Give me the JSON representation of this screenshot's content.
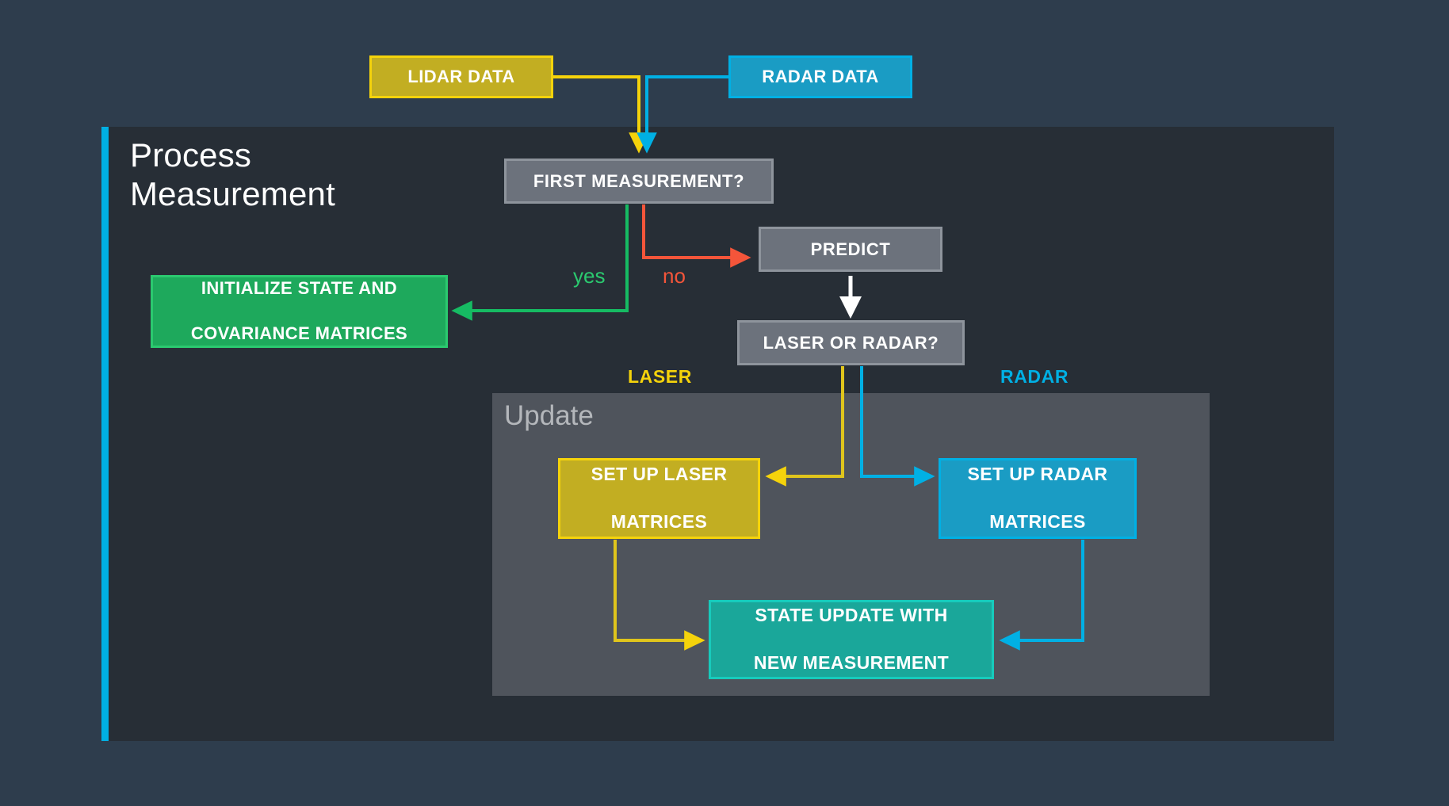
{
  "diagram": {
    "title": "Process Measurement",
    "colors": {
      "background": "#2e3d4d",
      "panel": "#272e36",
      "accent_bar": "#00b0e4",
      "update_panel": "#4f545c",
      "lidar_yellow": "#f5d30b",
      "radar_blue": "#00b0e4",
      "green": "#2bc96f",
      "red": "#f4553a",
      "teal": "#17cbbc",
      "decision_gray": "#6c727c",
      "white": "#ffffff"
    }
  },
  "inputs": [
    {
      "id": "lidar",
      "label": "LIDAR DATA",
      "color": "#f5d30b"
    },
    {
      "id": "radar",
      "label": "RADAR DATA",
      "color": "#00b0e4"
    }
  ],
  "process_panel": {
    "title_line1": "Process",
    "title_line2": "Measurement",
    "nodes": {
      "first_measurement": "FIRST MEASUREMENT?",
      "predict": "PREDICT",
      "laser_or_radar": "LASER OR RADAR?",
      "initialize_line1": "INITIALIZE STATE AND",
      "initialize_line2": "COVARIANCE MATRICES"
    },
    "edge_labels": {
      "yes": "yes",
      "no": "no",
      "laser": "LASER",
      "radar": "RADAR"
    }
  },
  "update_panel": {
    "title": "Update",
    "nodes": {
      "set_up_laser_line1": "SET UP LASER",
      "set_up_laser_line2": "MATRICES",
      "set_up_radar_line1": "SET UP RADAR",
      "set_up_radar_line2": "MATRICES",
      "state_update_line1": "STATE UPDATE WITH",
      "state_update_line2": "NEW MEASUREMENT"
    }
  }
}
